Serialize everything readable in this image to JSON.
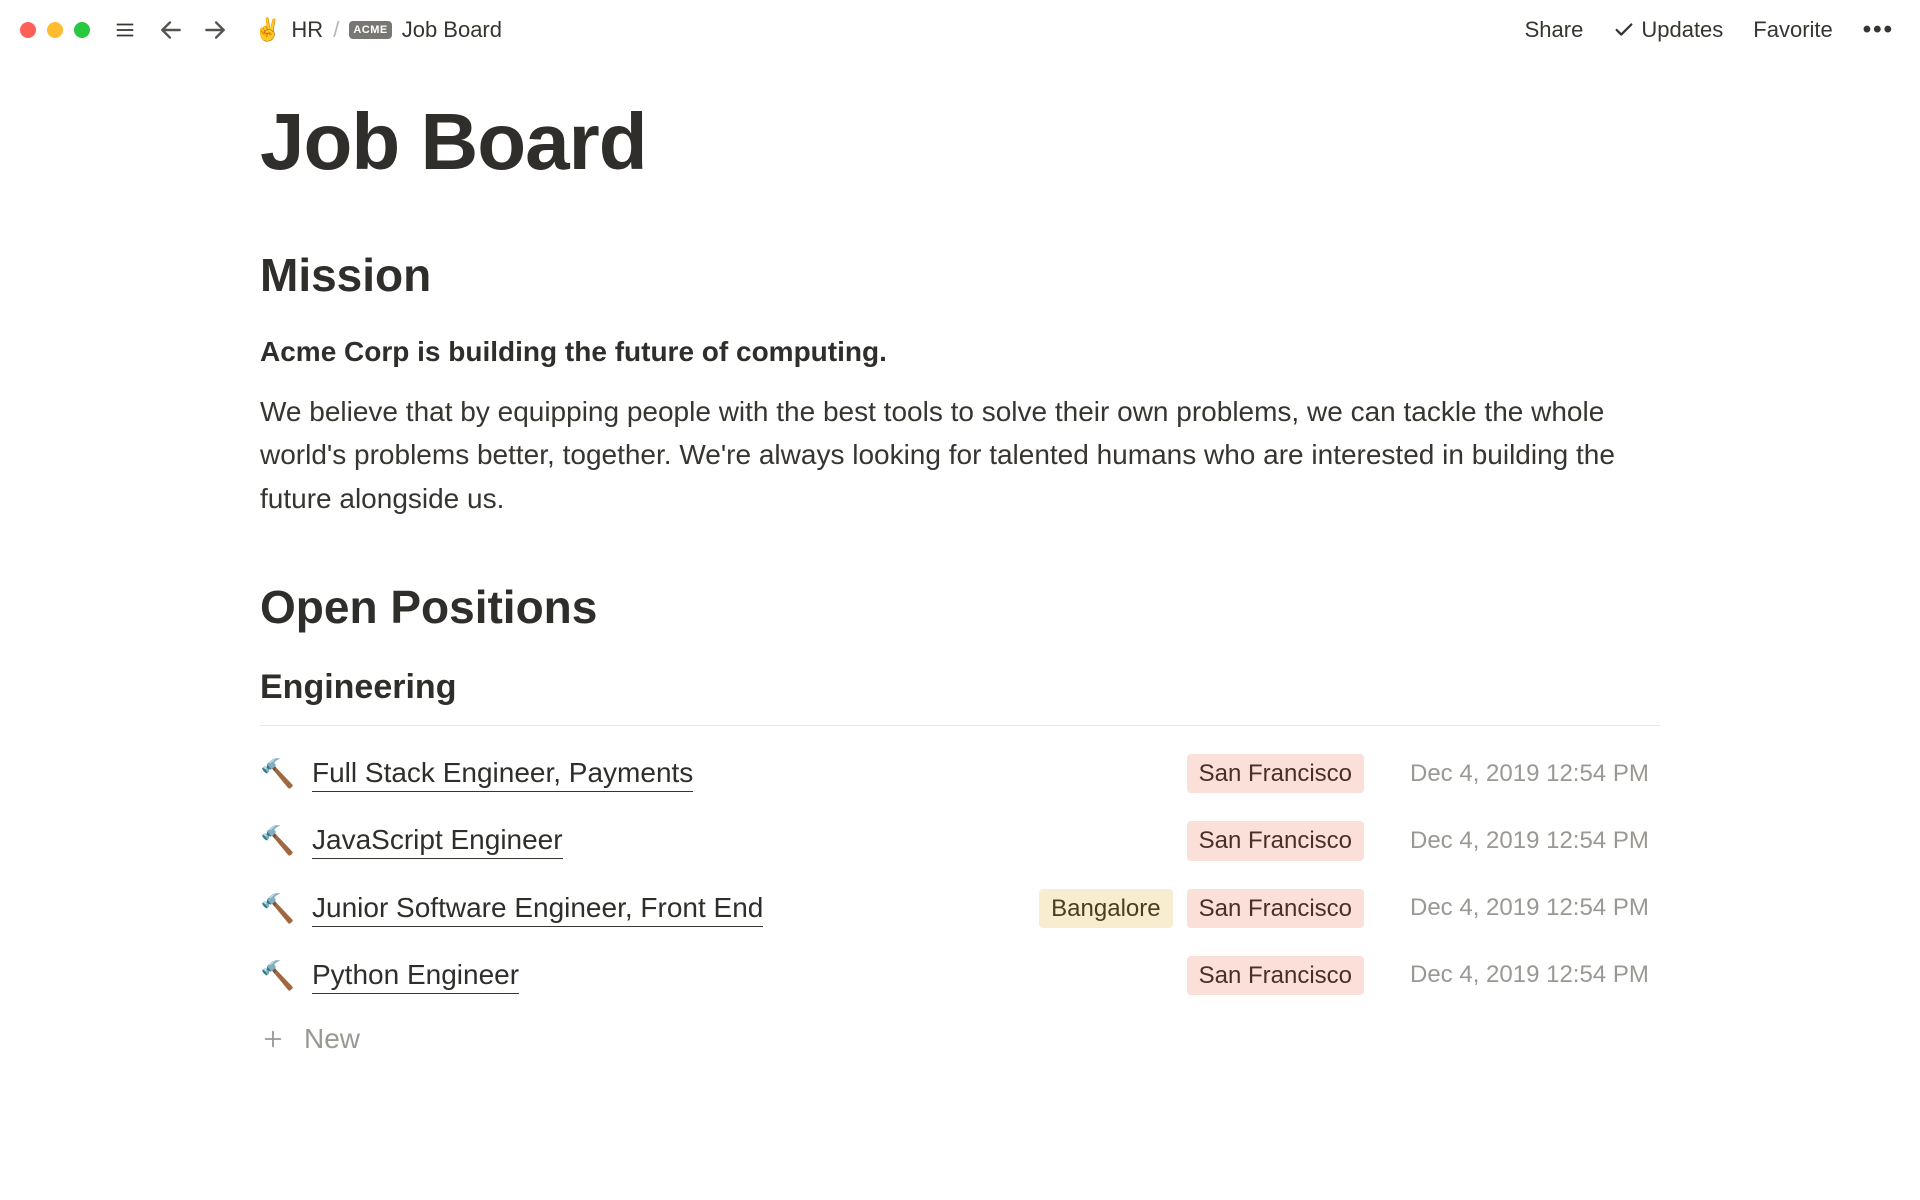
{
  "breadcrumbs": {
    "root_emoji": "✌️",
    "root_label": "HR",
    "separator": "/",
    "chip_label": "ACME",
    "current_label": "Job Board"
  },
  "topbar": {
    "share": "Share",
    "updates": "Updates",
    "favorite": "Favorite"
  },
  "page": {
    "title": "Job Board",
    "mission_heading": "Mission",
    "mission_lead": "Acme Corp is building the future of computing.",
    "mission_body": "We believe that by equipping people with the best tools to solve their own problems, we can tackle the whole world's problems better, together. We're always looking for talented humans who are interested in building the future alongside us.",
    "positions_heading": "Open Positions",
    "category_heading": "Engineering",
    "new_label": "New"
  },
  "jobs": [
    {
      "icon": "🔨",
      "title": "Full Stack Engineer, Payments",
      "locations": [
        "San Francisco"
      ],
      "date": "Dec 4, 2019 12:54 PM"
    },
    {
      "icon": "🔨",
      "title": "JavaScript Engineer",
      "locations": [
        "San Francisco"
      ],
      "date": "Dec 4, 2019 12:54 PM"
    },
    {
      "icon": "🔨",
      "title": "Junior Software Engineer, Front End",
      "locations": [
        "Bangalore",
        "San Francisco"
      ],
      "date": "Dec 4, 2019 12:54 PM"
    },
    {
      "icon": "🔨",
      "title": "Python Engineer",
      "locations": [
        "San Francisco"
      ],
      "date": "Dec 4, 2019 12:54 PM"
    }
  ],
  "location_styles": {
    "San Francisco": "tag-sf",
    "Bangalore": "tag-blr"
  }
}
